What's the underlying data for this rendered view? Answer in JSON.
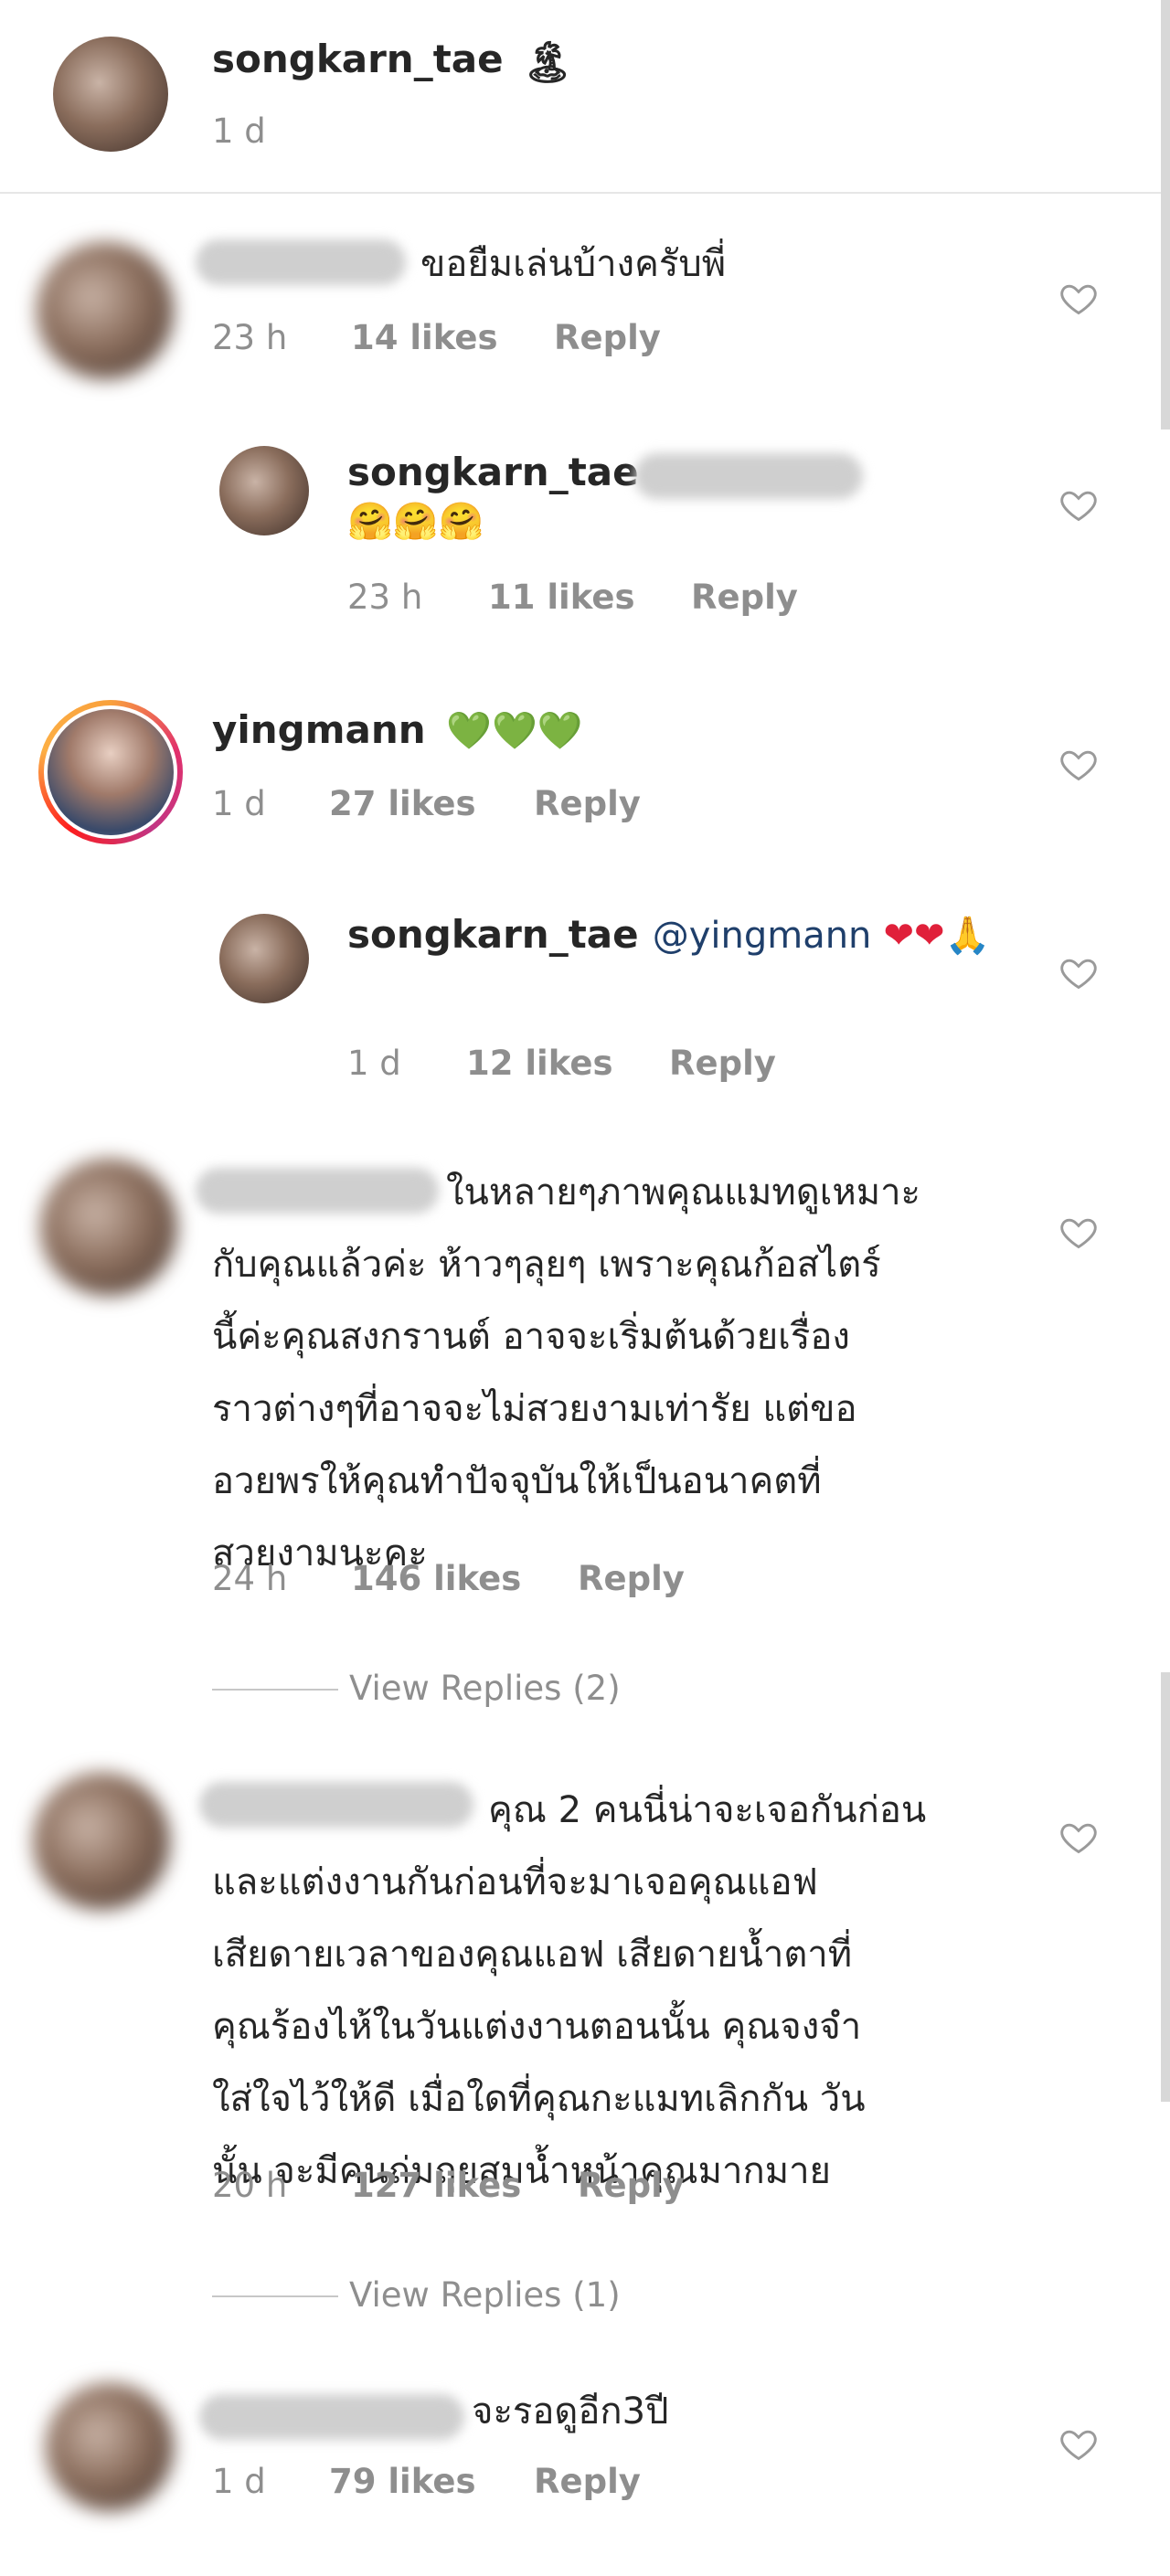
{
  "header": {
    "username": "songkarn_tae",
    "emoji": "🏝",
    "time": "1 d"
  },
  "comments": [
    {
      "id": "c1",
      "text": "ขอยืมเล่นบ้างครับพี่",
      "time": "23 h",
      "likes": "14 likes",
      "reply": "Reply"
    },
    {
      "id": "r1",
      "username": "songkarn_tae",
      "emoji": "🤗🤗🤗",
      "time": "23 h",
      "likes": "11 likes",
      "reply": "Reply"
    },
    {
      "id": "c2",
      "username": "yingmann",
      "emoji": "💚💚💚",
      "time": "1 d",
      "likes": "27 likes",
      "reply": "Reply"
    },
    {
      "id": "r2",
      "username": "songkarn_tae",
      "mention": "@yingmann",
      "emoji": "❤❤🙏",
      "time": "1 d",
      "likes": "12 likes",
      "reply": "Reply"
    },
    {
      "id": "c3",
      "lines": [
        "ในหลายๆภาพคุณแมทดูเหมาะ",
        "กับคุณแล้วค่ะ ห้าวๆลุยๆ เพราะคุณก้อสไตร์",
        "นี้ค่ะคุณสงกรานต์  อาจจะเริ่มต้นด้วยเรื่อง",
        "ราวต่างๆที่อาจจะไม่สวยงามเท่ารัย แต่ขอ",
        "อวยพรให้คุณทำปัจจุบันให้เป็นอนาคตที่",
        "สวยงามนะคะ"
      ],
      "time": "24 h",
      "likes": "146 likes",
      "reply": "Reply",
      "view_replies": "View Replies (2)"
    },
    {
      "id": "c4",
      "lines": [
        "คุณ 2 คนนี่น่าจะเจอกันก่อน",
        "และแต่งงานกันก่อนที่จะมาเจอคุณแอฟ",
        "เสียดายเวลาของคุณแอฟ เสียดายน้ำตาที่",
        "คุณร้องไห้ในวันแต่งงานตอนนั้น คุณจงจำ",
        "ใส่ใจไว้ให้ดี เมื่อใดที่คุณกะแมทเลิกกัน วัน",
        "นั้น จะมีคนถ่มถุยสมน้ำหน้าคุณมากมาย"
      ],
      "time": "20 h",
      "likes": "127 likes",
      "reply": "Reply",
      "view_replies": "View Replies (1)"
    },
    {
      "id": "c5",
      "text": "จะรอดูอีก3ปี",
      "time": "1 d",
      "likes": "79 likes",
      "reply": "Reply"
    }
  ],
  "colors": {
    "text": "#262626",
    "meta": "#8e8e8e",
    "mention": "#1f3f6b",
    "heart_outline": "#9a9a9a"
  },
  "icons": {
    "like": "heart-outline-icon",
    "avatar": "profile-photo"
  }
}
